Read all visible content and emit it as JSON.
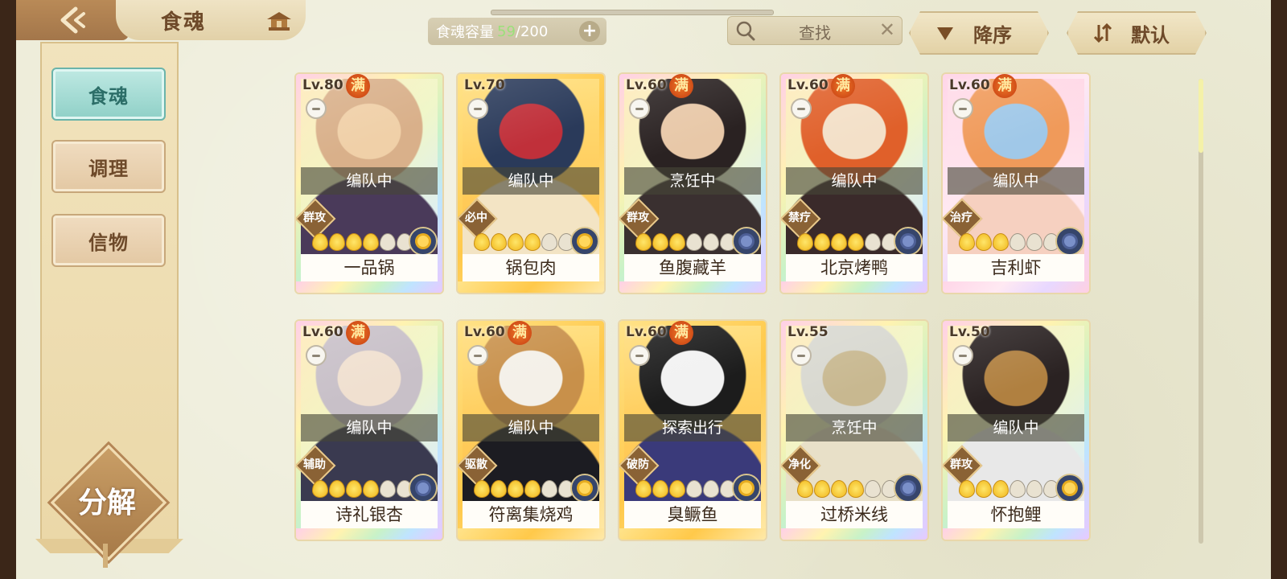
{
  "header": {
    "title": "食魂"
  },
  "capacity": {
    "label": "食魂容量",
    "current": "59",
    "max": "/200"
  },
  "search": {
    "placeholder": "查找"
  },
  "sort": {
    "order_label": "降序",
    "default_label": "默认"
  },
  "sidebar": {
    "items": [
      {
        "label": "食魂",
        "active": true
      },
      {
        "label": "调理",
        "active": false
      },
      {
        "label": "信物",
        "active": false
      }
    ]
  },
  "decompose_label": "分解",
  "cards": [
    {
      "level": "Lv.80",
      "max_badge": "满",
      "status": "编队中",
      "role": "群攻",
      "stars": 4,
      "name": "一品锅",
      "rarity": "rainbow",
      "element": "gold"
    },
    {
      "level": "Lv.70",
      "max_badge": "",
      "status": "编队中",
      "role": "必中",
      "stars": 4,
      "name": "锅包肉",
      "rarity": "gold",
      "element": "gold"
    },
    {
      "level": "Lv.60",
      "max_badge": "满",
      "status": "烹饪中",
      "role": "群攻",
      "stars": 3,
      "name": "鱼腹藏羊",
      "rarity": "rainbow",
      "element": "blue"
    },
    {
      "level": "Lv.60",
      "max_badge": "满",
      "status": "编队中",
      "role": "禁疗",
      "stars": 4,
      "name": "北京烤鸭",
      "rarity": "rainbow",
      "element": "blue"
    },
    {
      "level": "Lv.60",
      "max_badge": "满",
      "status": "编队中",
      "role": "治疗",
      "stars": 3,
      "name": "吉利虾",
      "rarity": "pink",
      "element": "blue"
    },
    {
      "level": "Lv.60",
      "max_badge": "满",
      "status": "编队中",
      "role": "辅助",
      "stars": 4,
      "name": "诗礼银杏",
      "rarity": "rainbow",
      "element": "blue"
    },
    {
      "level": "Lv.60",
      "max_badge": "满",
      "status": "编队中",
      "role": "驱散",
      "stars": 4,
      "name": "符离集烧鸡",
      "rarity": "gold",
      "element": "gold"
    },
    {
      "level": "Lv.60",
      "max_badge": "满",
      "status": "探索出行",
      "role": "破防",
      "stars": 3,
      "name": "臭鳜鱼",
      "rarity": "gold",
      "element": "gold"
    },
    {
      "level": "Lv.55",
      "max_badge": "",
      "status": "烹饪中",
      "role": "净化",
      "stars": 4,
      "name": "过桥米线",
      "rarity": "rainbow",
      "element": "blue"
    },
    {
      "level": "Lv.50",
      "max_badge": "",
      "status": "编队中",
      "role": "群攻",
      "stars": 3,
      "name": "怀抱鲤",
      "rarity": "rainbow",
      "element": "gold"
    }
  ]
}
